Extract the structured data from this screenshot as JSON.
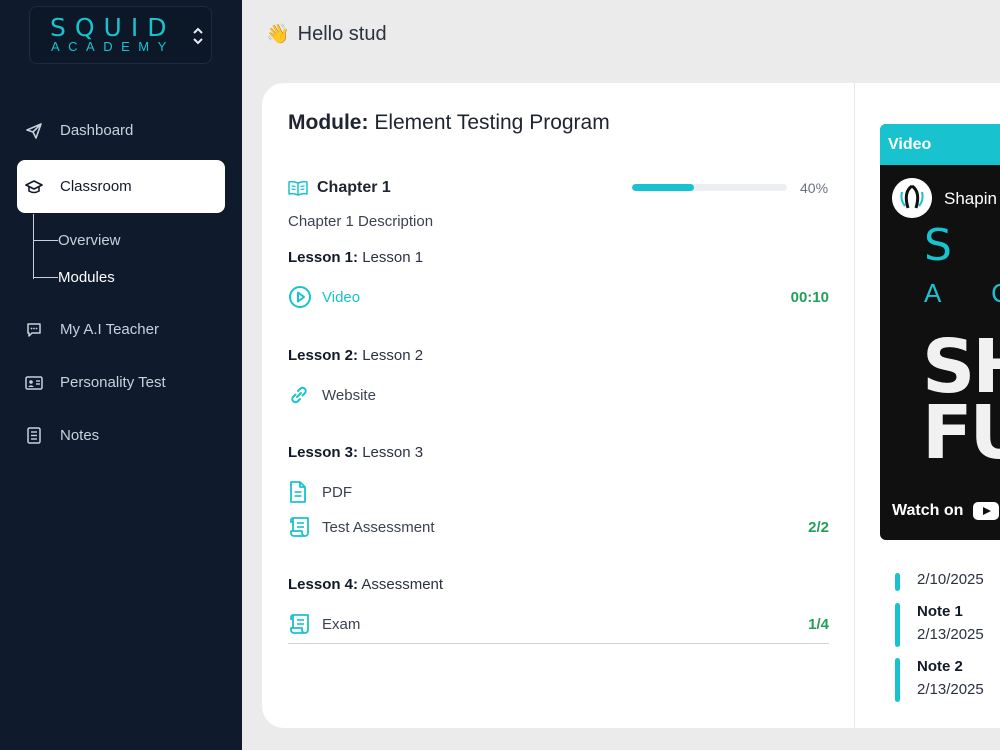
{
  "brand": {
    "name_top": "SQUID",
    "name_bottom": "ACADEMY"
  },
  "sidebar": {
    "items": [
      {
        "label": "Dashboard",
        "icon": "paper-plane-icon"
      },
      {
        "label": "Classroom",
        "icon": "graduation-cap-icon",
        "active": true
      },
      {
        "label": "My A.I Teacher",
        "icon": "chat-bubble-icon"
      },
      {
        "label": "Personality Test",
        "icon": "id-card-icon"
      },
      {
        "label": "Notes",
        "icon": "notebook-icon"
      }
    ],
    "sub_items": [
      {
        "label": "Overview"
      },
      {
        "label": "Modules",
        "active": true
      }
    ]
  },
  "header": {
    "greeting": "Hello stud",
    "emoji": "👋"
  },
  "module": {
    "prefix": "Module:",
    "name": "Element Testing Program",
    "chapter": {
      "title": "Chapter 1",
      "description": "Chapter 1 Description",
      "progress_percent": 40,
      "progress_label": "40%"
    },
    "lessons": [
      {
        "prefix": "Lesson 1:",
        "name": "Lesson 1",
        "items": [
          {
            "label": "Video",
            "icon": "play-circle-icon",
            "meta": "00:10"
          }
        ]
      },
      {
        "prefix": "Lesson 2:",
        "name": "Lesson 2",
        "items": [
          {
            "label": "Website",
            "icon": "link-icon",
            "meta": ""
          }
        ]
      },
      {
        "prefix": "Lesson 3:",
        "name": "Lesson 3",
        "items": [
          {
            "label": "PDF",
            "icon": "document-icon",
            "meta": ""
          },
          {
            "label": "Test Assessment",
            "icon": "scroll-icon",
            "meta": "2/2"
          }
        ]
      },
      {
        "prefix": "Lesson 4:",
        "name": "Assessment",
        "items": [
          {
            "label": "Exam",
            "icon": "scroll-icon",
            "meta": "1/4"
          }
        ]
      }
    ]
  },
  "video_panel": {
    "header": "Video",
    "yt_title": "Shapin",
    "big_s": "S",
    "big_a": "A C",
    "big_line1": "SHA",
    "big_line2": "FUT",
    "watch_on": "Watch on"
  },
  "notes": [
    {
      "title": "",
      "date": "2/10/2025"
    },
    {
      "title": "Note 1",
      "date": "2/13/2025"
    },
    {
      "title": "Note 2",
      "date": "2/13/2025"
    }
  ],
  "colors": {
    "accent": "#19c2cf",
    "sidebar": "#0f1b2d",
    "success": "#22a05a"
  }
}
